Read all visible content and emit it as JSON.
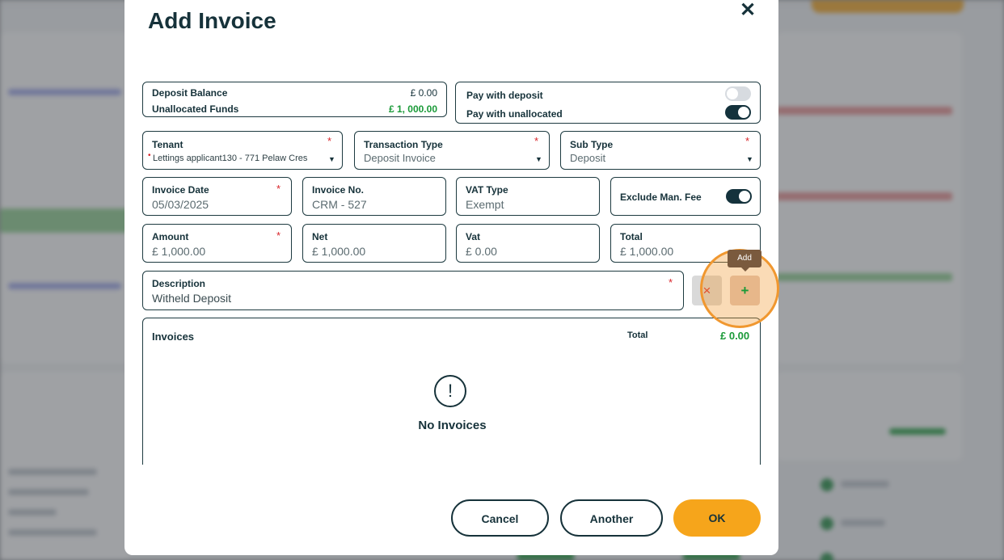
{
  "modal": {
    "title": "Add Invoice",
    "close_label": "✕"
  },
  "balances": {
    "deposit_label": "Deposit Balance",
    "deposit_value": "£ 0.00",
    "unallocated_label": "Unallocated Funds",
    "unallocated_value": "£ 1, 000.00"
  },
  "pay": {
    "with_deposit_label": "Pay with deposit",
    "with_deposit_on": false,
    "with_unallocated_label": "Pay with unallocated",
    "with_unallocated_on": true
  },
  "tenant": {
    "label": "Tenant",
    "value": "Lettings applicant130 - 771 Pelaw Cres"
  },
  "transaction_type": {
    "label": "Transaction Type",
    "value": "Deposit Invoice"
  },
  "sub_type": {
    "label": "Sub Type",
    "value": "Deposit"
  },
  "invoice_date": {
    "label": "Invoice Date",
    "value": "05/03/2025"
  },
  "invoice_no": {
    "label": "Invoice No.",
    "value": "CRM - 527"
  },
  "vat_type": {
    "label": "VAT Type",
    "value": "Exempt"
  },
  "exclude_fee": {
    "label": "Exclude Man. Fee",
    "on": true
  },
  "amount": {
    "label": "Amount",
    "value": "£ 1,000.00"
  },
  "net": {
    "label": "Net",
    "value": "£ 1,000.00"
  },
  "vat": {
    "label": "Vat",
    "value": "£ 0.00"
  },
  "total": {
    "label": "Total",
    "value": "£ 1,000.00"
  },
  "description": {
    "label": "Description",
    "value": "Witheld Deposit"
  },
  "actions": {
    "clear_icon": "×",
    "add_icon": "+",
    "add_tooltip": "Add"
  },
  "invoices": {
    "title": "Invoices",
    "total_label": "Total",
    "total_value": "£ 0.00",
    "empty_icon": "!",
    "empty_text": "No Invoices"
  },
  "footer": {
    "cancel_label": "Cancel",
    "another_label": "Another",
    "ok_label": "OK"
  },
  "colors": {
    "accent": "#f6a51b",
    "primary": "#14323c",
    "positive": "#1a9a38",
    "required": "#d9252a"
  }
}
